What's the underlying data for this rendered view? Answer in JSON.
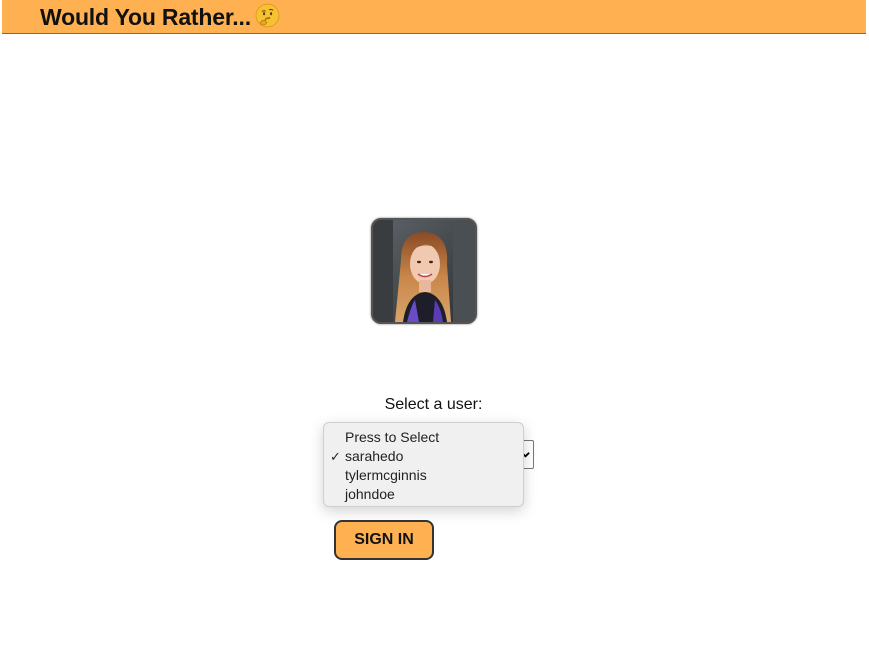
{
  "header": {
    "title": "Would You Rather...",
    "emoji_icon": "thinking-face-icon",
    "background_color": "#ffb152"
  },
  "avatar": {
    "icon": "user-avatar-photo"
  },
  "login": {
    "select_label": "Select a user:",
    "select_value": "sarahedo",
    "options": [
      {
        "label": "Press to Select",
        "selected": false
      },
      {
        "label": "sarahedo",
        "selected": true
      },
      {
        "label": "tylermcginnis",
        "selected": false
      },
      {
        "label": "johndoe",
        "selected": false
      }
    ],
    "check_glyph": "✓",
    "signin_label": "SIGN IN",
    "button_color": "#ffb152"
  }
}
